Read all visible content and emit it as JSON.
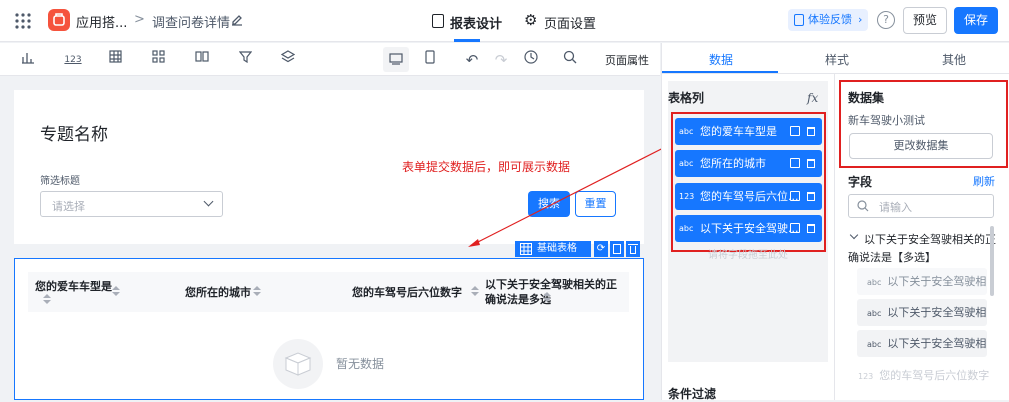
{
  "header": {
    "app_name": "应用搭...",
    "breadcrumb_separator": ">",
    "page_title": "调查问卷详情",
    "tab_report": "报表设计",
    "tab_page": "页面设置",
    "feedback": "体验反馈",
    "preview": "预览",
    "save": "保存"
  },
  "toolbar": {
    "page_props": "页面属性",
    "number_glyph": "123"
  },
  "canvas": {
    "topic_title": "专题名称",
    "filter_label": "筛选标题",
    "select_placeholder": "请选择",
    "search_button": "搜索",
    "reset_button": "重置",
    "annotation": "表单提交数据后，即可展示数据",
    "table_tag": "基础表格",
    "columns": [
      "您的爱车车型是",
      "您所在的城市",
      "您的车驾号后六位数字",
      "以下关于安全驾驶相关的正确说法是多选"
    ],
    "empty_text": "暂无数据"
  },
  "right_panel": {
    "tabs": [
      "数据",
      "样式",
      "其他"
    ],
    "table_columns_title": "表格列",
    "fx": "fx",
    "column_items": [
      {
        "type": "abc",
        "label": "您的爱车车型是"
      },
      {
        "type": "abc",
        "label": "您所在的城市"
      },
      {
        "type": "123",
        "label": "您的车驾号后六位..."
      },
      {
        "type": "abc",
        "label": "以下关于安全驾驶..."
      }
    ],
    "drag_hint": "请将字段拖至此处",
    "condition_filter": "条件过滤",
    "dataset_title": "数据集",
    "dataset_name": "新车驾驶小测试",
    "change_dataset": "更改数据集",
    "fields_title": "字段",
    "refresh": "刷新",
    "fields_search_placeholder": "请输入",
    "group_label_line1": "以下关于安全驾驶相关的正",
    "group_label_line2": "确说法是【多选】",
    "field_items": [
      {
        "type": "abc",
        "label": "以下关于安全驾驶相..."
      },
      {
        "type": "abc",
        "label": "以下关于安全驾驶相..."
      },
      {
        "type": "abc",
        "label": "以下关于安全驾驶相..."
      },
      {
        "type": "123",
        "label": "您的车驾号后六位数字"
      }
    ]
  },
  "colors": {
    "primary": "#1677ff",
    "annotation_red": "#e02020"
  }
}
